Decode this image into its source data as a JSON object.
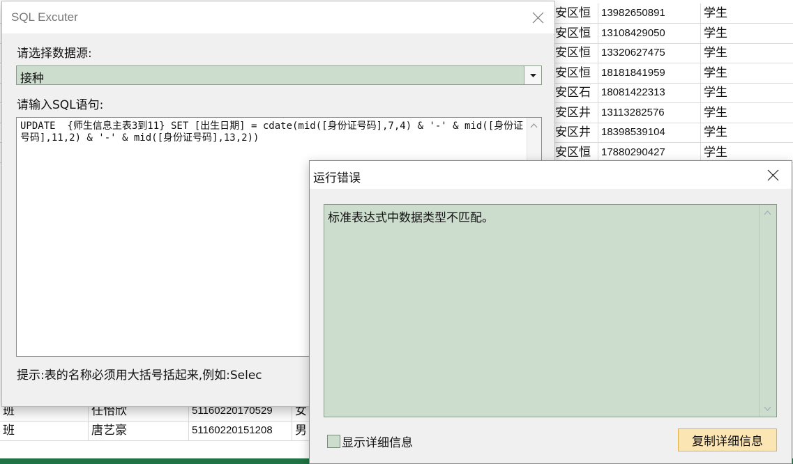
{
  "sheet": {
    "rows_right": [
      {
        "area": "安区恒",
        "phone": "13982650891",
        "role": "学生"
      },
      {
        "area": "安区恒",
        "phone": "13108429050",
        "role": "学生"
      },
      {
        "area": "安区恒",
        "phone": "13320627475",
        "role": "学生"
      },
      {
        "area": "安区恒",
        "phone": "18181841959",
        "role": "学生"
      },
      {
        "area": "安区石",
        "phone": "18081422313",
        "role": "学生"
      },
      {
        "area": "安区井",
        "phone": "13113282576",
        "role": "学生"
      },
      {
        "area": "安区井",
        "phone": "18398539104",
        "role": "学生"
      },
      {
        "area": "安区恒",
        "phone": "17880290427",
        "role": "学生"
      }
    ],
    "rows_bottom": [
      {
        "cls": "班",
        "name": "任怡欣",
        "id": "51160220170529",
        "sex": "女"
      },
      {
        "cls": "班",
        "name": "唐艺豪",
        "id": "51160220151208",
        "sex": "男"
      }
    ]
  },
  "sql_window": {
    "title": "SQL Excuter",
    "source_label": "请选择数据源:",
    "source_value": "接种",
    "sql_label": "请输入SQL语句:",
    "sql_text": "UPDATE  {师生信息主表3到11} SET [出生日期] = cdate(mid([身份证号码],7,4) & '-' & mid([身份证号码],11,2) & '-' & mid([身份证号码],13,2))",
    "hint": "提示:表的名称必须用大括号括起来,例如:Selec"
  },
  "error_dialog": {
    "title": "运行错误",
    "message": "标准表达式中数据类型不匹配。",
    "show_details_label": "显示详细信息",
    "copy_button_label": "复制详细信息"
  },
  "colors": {
    "field_green": "#ccdccd",
    "copy_button": "#fbe5b3",
    "excel_green": "#217346"
  }
}
